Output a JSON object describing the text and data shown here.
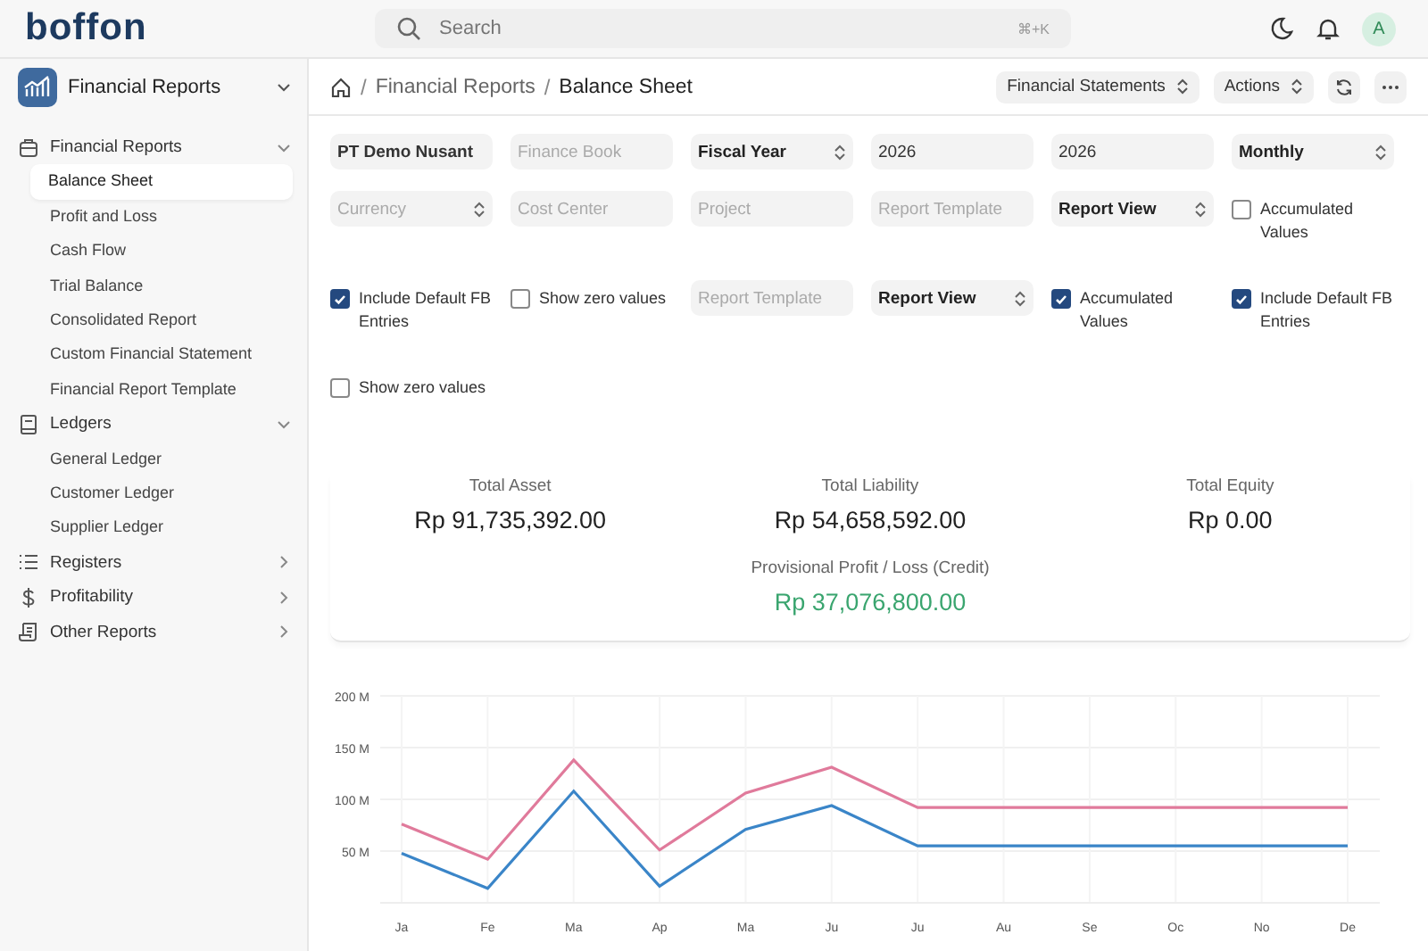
{
  "topbar": {
    "logo": "boffon",
    "search": {
      "placeholder": "Search",
      "shortcut": "⌘+K"
    },
    "avatar": "A"
  },
  "sidebar": {
    "workspace": "Financial Reports",
    "groups": [
      {
        "label": "Financial Reports",
        "expanded": true,
        "children": [
          {
            "label": "Balance Sheet",
            "selected": true
          },
          {
            "label": "Profit and Loss",
            "selected": false
          },
          {
            "label": "Cash Flow",
            "selected": false
          },
          {
            "label": "Trial Balance",
            "selected": false
          },
          {
            "label": "Consolidated Report",
            "selected": false
          },
          {
            "label": "Custom Financial Statement",
            "selected": false
          },
          {
            "label": "Financial Report Template",
            "selected": false
          }
        ]
      },
      {
        "label": "Ledgers",
        "expanded": true,
        "children": [
          {
            "label": "General Ledger",
            "selected": false
          },
          {
            "label": "Customer Ledger",
            "selected": false
          },
          {
            "label": "Supplier Ledger",
            "selected": false
          }
        ]
      },
      {
        "label": "Registers",
        "expanded": false
      },
      {
        "label": "Profitability",
        "expanded": false
      },
      {
        "label": "Other Reports",
        "expanded": false
      }
    ]
  },
  "header": {
    "separator": "/",
    "breadcrumbs": [
      "Financial Reports",
      "Balance Sheet"
    ],
    "buttons": [
      "Financial Statements",
      "Actions"
    ]
  },
  "filters": [
    {
      "kind": "input",
      "value": "PT Demo Nusant"
    },
    {
      "kind": "input",
      "placeholder": "Finance Book"
    },
    {
      "kind": "select",
      "value": "Fiscal Year"
    },
    {
      "kind": "input",
      "value": "2026"
    },
    {
      "kind": "input",
      "value": "2026"
    },
    {
      "kind": "select",
      "value": "Monthly"
    },
    {
      "kind": "select",
      "placeholder": "Currency"
    },
    {
      "kind": "input",
      "placeholder": "Cost Center"
    },
    {
      "kind": "input",
      "placeholder": "Project"
    },
    {
      "kind": "input",
      "placeholder": "Report Template"
    },
    {
      "kind": "select",
      "value": "Report View"
    },
    {
      "kind": "checkbox",
      "label": "Accumulated Values",
      "checked": false
    },
    {
      "kind": "checkbox",
      "label": "Include Default FB Entries",
      "checked": true
    },
    {
      "kind": "checkbox",
      "label": "Show zero values",
      "checked": false
    },
    {
      "kind": "input",
      "placeholder": "Report Template"
    },
    {
      "kind": "select",
      "value": "Report View"
    },
    {
      "kind": "checkbox",
      "label": "Accumulated Values",
      "checked": true
    },
    {
      "kind": "checkbox",
      "label": "Include Default FB Entries",
      "checked": true
    },
    {
      "kind": "checkbox",
      "label": "Show zero values",
      "checked": false
    }
  ],
  "summary": [
    {
      "label": "Total Asset",
      "value": "Rp 91,735,392.00"
    },
    {
      "label": "Total Liability",
      "value": "Rp 54,658,592.00"
    },
    {
      "label": "Total Equity",
      "value": "Rp 0.00"
    }
  ],
  "provisional": {
    "label": "Provisional Profit / Loss (Credit)",
    "value": "Rp 37,076,800.00"
  },
  "chart_data": {
    "type": "line",
    "grid": true,
    "categories": [
      "Ja",
      "Fe",
      "Ma",
      "Ap",
      "Ma",
      "Ju",
      "Ju",
      "Au",
      "Se",
      "Oc",
      "No",
      "De"
    ],
    "series": [
      {
        "color": "#e07a9b",
        "values": [
          76,
          42,
          138,
          51,
          106,
          131,
          92,
          92,
          92,
          92,
          92,
          92
        ]
      },
      {
        "color": "#3a85c8",
        "values": [
          48,
          14,
          108,
          16,
          71,
          94,
          55,
          55,
          55,
          55,
          55,
          55
        ]
      }
    ],
    "ylim": [
      0,
      200
    ],
    "yticks": [
      {
        "value": 50,
        "label": "50 M"
      },
      {
        "value": 100,
        "label": "100 M"
      },
      {
        "value": 150,
        "label": "150 M"
      },
      {
        "value": 200,
        "label": "200 M"
      }
    ]
  }
}
